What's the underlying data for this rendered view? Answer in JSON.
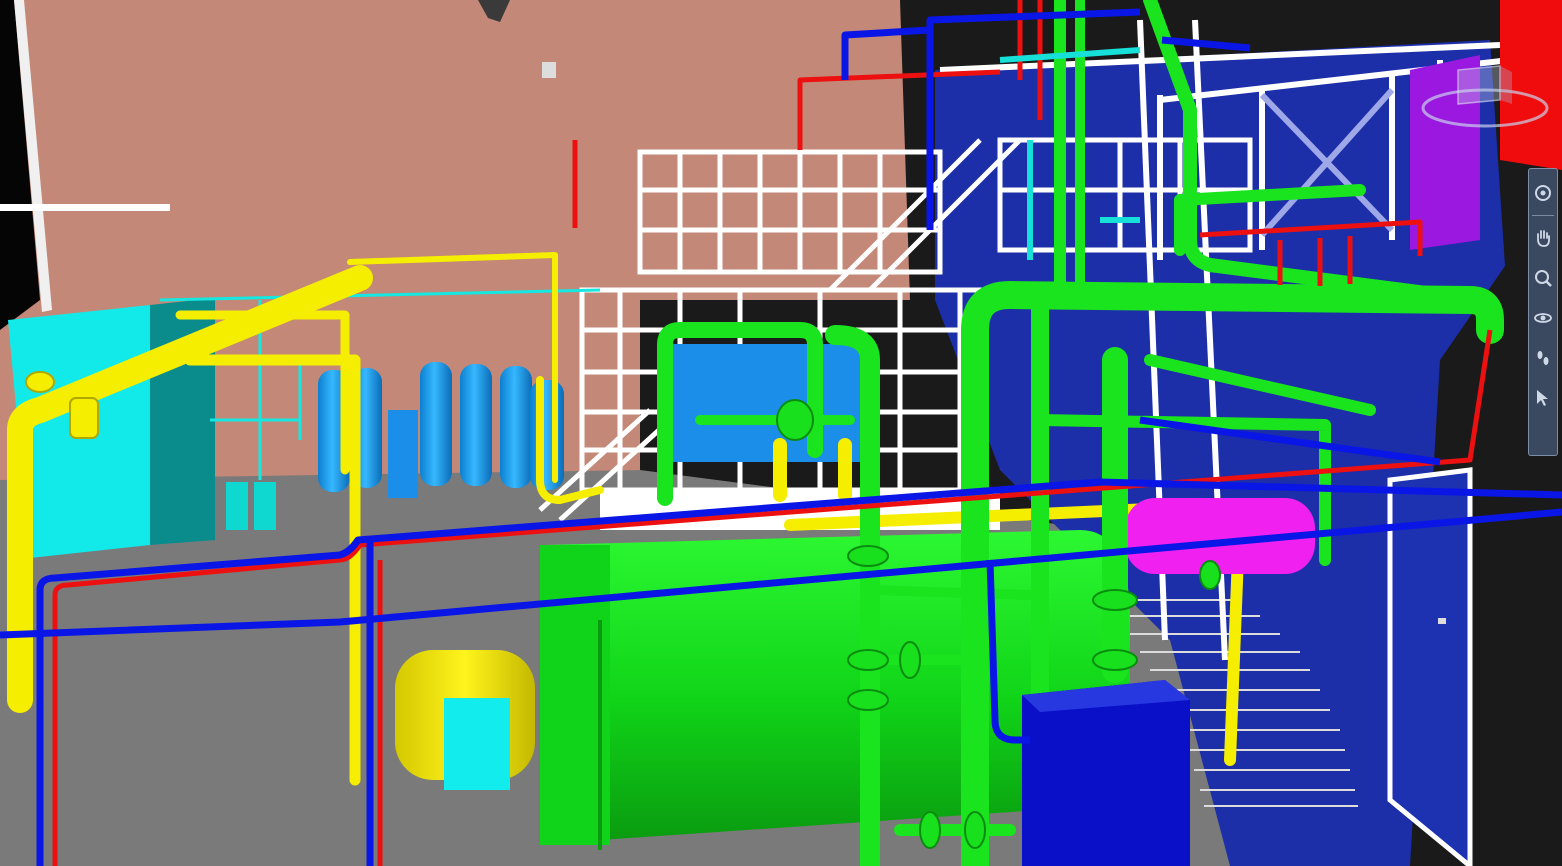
{
  "window": {
    "title": ""
  },
  "navigation_bar": {
    "tools": [
      {
        "icon": "steering-wheel-icon"
      },
      {
        "icon": "pan-hand-icon"
      },
      {
        "icon": "zoom-icon"
      },
      {
        "icon": "orbit-icon"
      },
      {
        "icon": "look-footsteps-icon"
      },
      {
        "icon": "select-cursor-icon"
      }
    ]
  },
  "viewcube": {
    "icon": "viewcube-compass-icon"
  },
  "colors": {
    "background_wall": "#C58A7A",
    "floor": "#777777",
    "cold_water_pipe": "#0B16E0",
    "hot_water_pipe": "#E01010",
    "steam_pipe": "#16E81E",
    "gas_pipe": "#F5EE00",
    "cyan_equipment": "#12F0F0",
    "blue_tanks": "#1AA3F0",
    "magenta_tank": "#F01EF0",
    "wall_panel": "#1B2FA8",
    "structure": "#FFFFFF"
  }
}
